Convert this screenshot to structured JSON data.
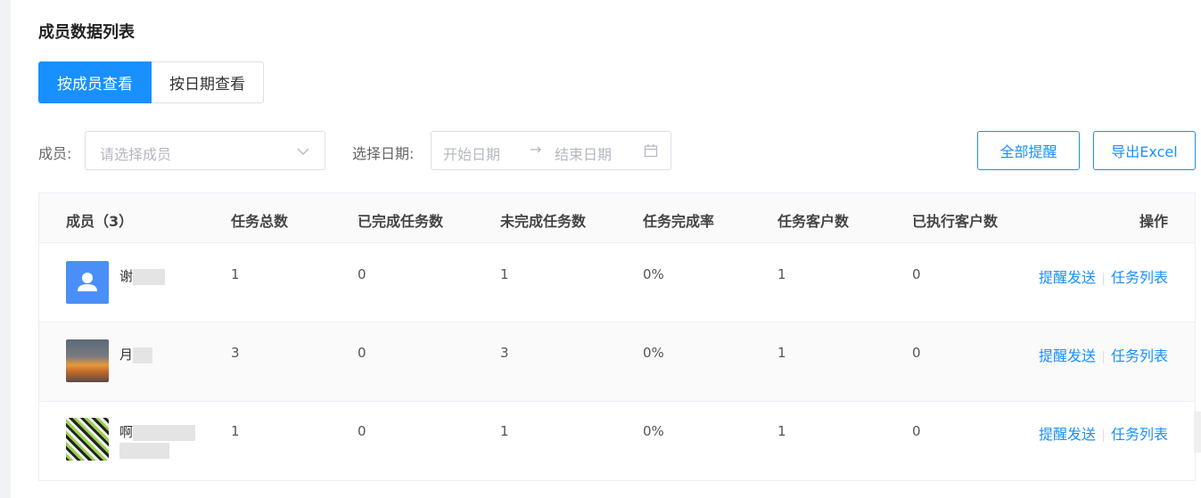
{
  "page": {
    "title": "成员数据列表"
  },
  "tabs": [
    {
      "label": "按成员查看",
      "active": true
    },
    {
      "label": "按日期查看",
      "active": false
    }
  ],
  "filters": {
    "member_label": "成员:",
    "member_placeholder": "请选择成员",
    "date_label": "选择日期:",
    "start_placeholder": "开始日期",
    "end_placeholder": "结束日期",
    "range_separator": "→"
  },
  "actions": {
    "remind_all": "全部提醒",
    "export_excel": "导出Excel"
  },
  "table": {
    "headers": {
      "member": "成员（3）",
      "total": "任务总数",
      "done": "已完成任务数",
      "undone": "未完成任务数",
      "rate": "任务完成率",
      "customers": "任务客户数",
      "executed": "已执行客户数",
      "ops": "操作"
    },
    "rows": [
      {
        "name": "谢",
        "avatar": "user-icon",
        "total": "1",
        "done": "0",
        "undone": "1",
        "rate": "0%",
        "customers": "1",
        "executed": "0",
        "op_remind": "提醒发送",
        "op_list": "任务列表"
      },
      {
        "name": "月",
        "avatar": "sunset-photo",
        "total": "3",
        "done": "0",
        "undone": "3",
        "rate": "0%",
        "customers": "1",
        "executed": "0",
        "op_remind": "提醒发送",
        "op_list": "任务列表"
      },
      {
        "name": "啊",
        "avatar": "comic-photo",
        "total": "1",
        "done": "0",
        "undone": "1",
        "rate": "0%",
        "customers": "1",
        "executed": "0",
        "op_remind": "提醒发送",
        "op_list": "任务列表"
      }
    ]
  },
  "colors": {
    "accent": "#1890ff",
    "border": "#dcdfe6",
    "header_bg": "#fafafa"
  }
}
